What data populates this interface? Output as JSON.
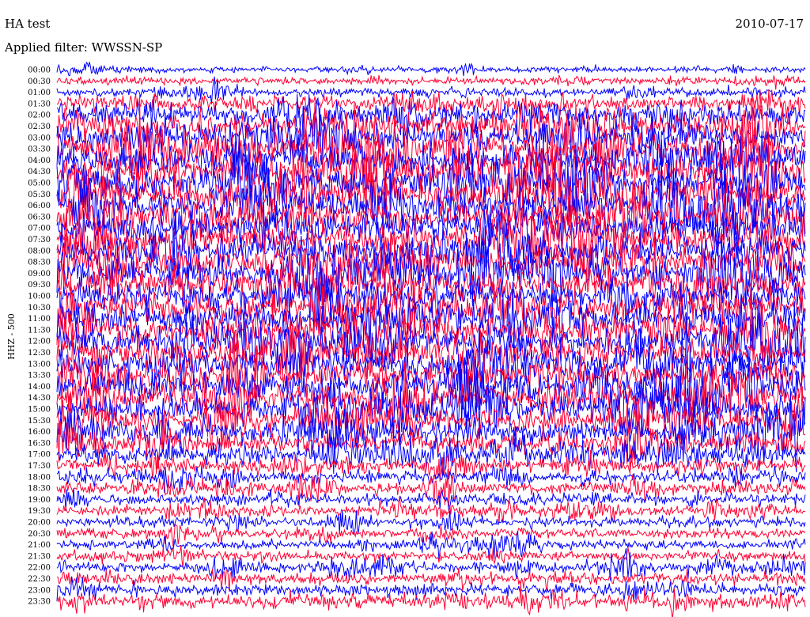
{
  "chart_data": {
    "type": "line",
    "title": "HA test",
    "date": "2010-07-17",
    "filter_label": "Applied filter: WWSSN-SP",
    "ylabel": "HHZ - 500",
    "row_labels": [
      "00:00",
      "00:30",
      "01:00",
      "01:30",
      "02:00",
      "02:30",
      "03:00",
      "03:30",
      "04:00",
      "04:30",
      "05:00",
      "05:30",
      "06:00",
      "06:30",
      "07:00",
      "07:30",
      "08:00",
      "08:30",
      "09:00",
      "09:30",
      "10:00",
      "10:30",
      "11:00",
      "11:30",
      "12:00",
      "12:30",
      "13:00",
      "13:30",
      "14:00",
      "14:30",
      "15:00",
      "15:30",
      "16:00",
      "16:30",
      "17:00",
      "17:30",
      "18:00",
      "18:30",
      "19:00",
      "19:30",
      "20:00",
      "20:30",
      "21:00",
      "21:30",
      "22:00",
      "22:30",
      "23:00",
      "23:30"
    ],
    "colors": [
      "#0000ff",
      "#ff0033"
    ],
    "row_activity": [
      0.15,
      0.2,
      0.25,
      0.5,
      0.7,
      0.8,
      0.9,
      1,
      1,
      1,
      1,
      1,
      1,
      1,
      1,
      1,
      1,
      1,
      1,
      1,
      1,
      1,
      1,
      1,
      1,
      1,
      1,
      0.95,
      0.95,
      0.9,
      0.9,
      0.8,
      0.8,
      0.7,
      0.55,
      0.45,
      0.4,
      0.35,
      0.3,
      0.28,
      0.26,
      0.25,
      0.25,
      0.28,
      0.3,
      0.35,
      0.4,
      0.45
    ]
  }
}
